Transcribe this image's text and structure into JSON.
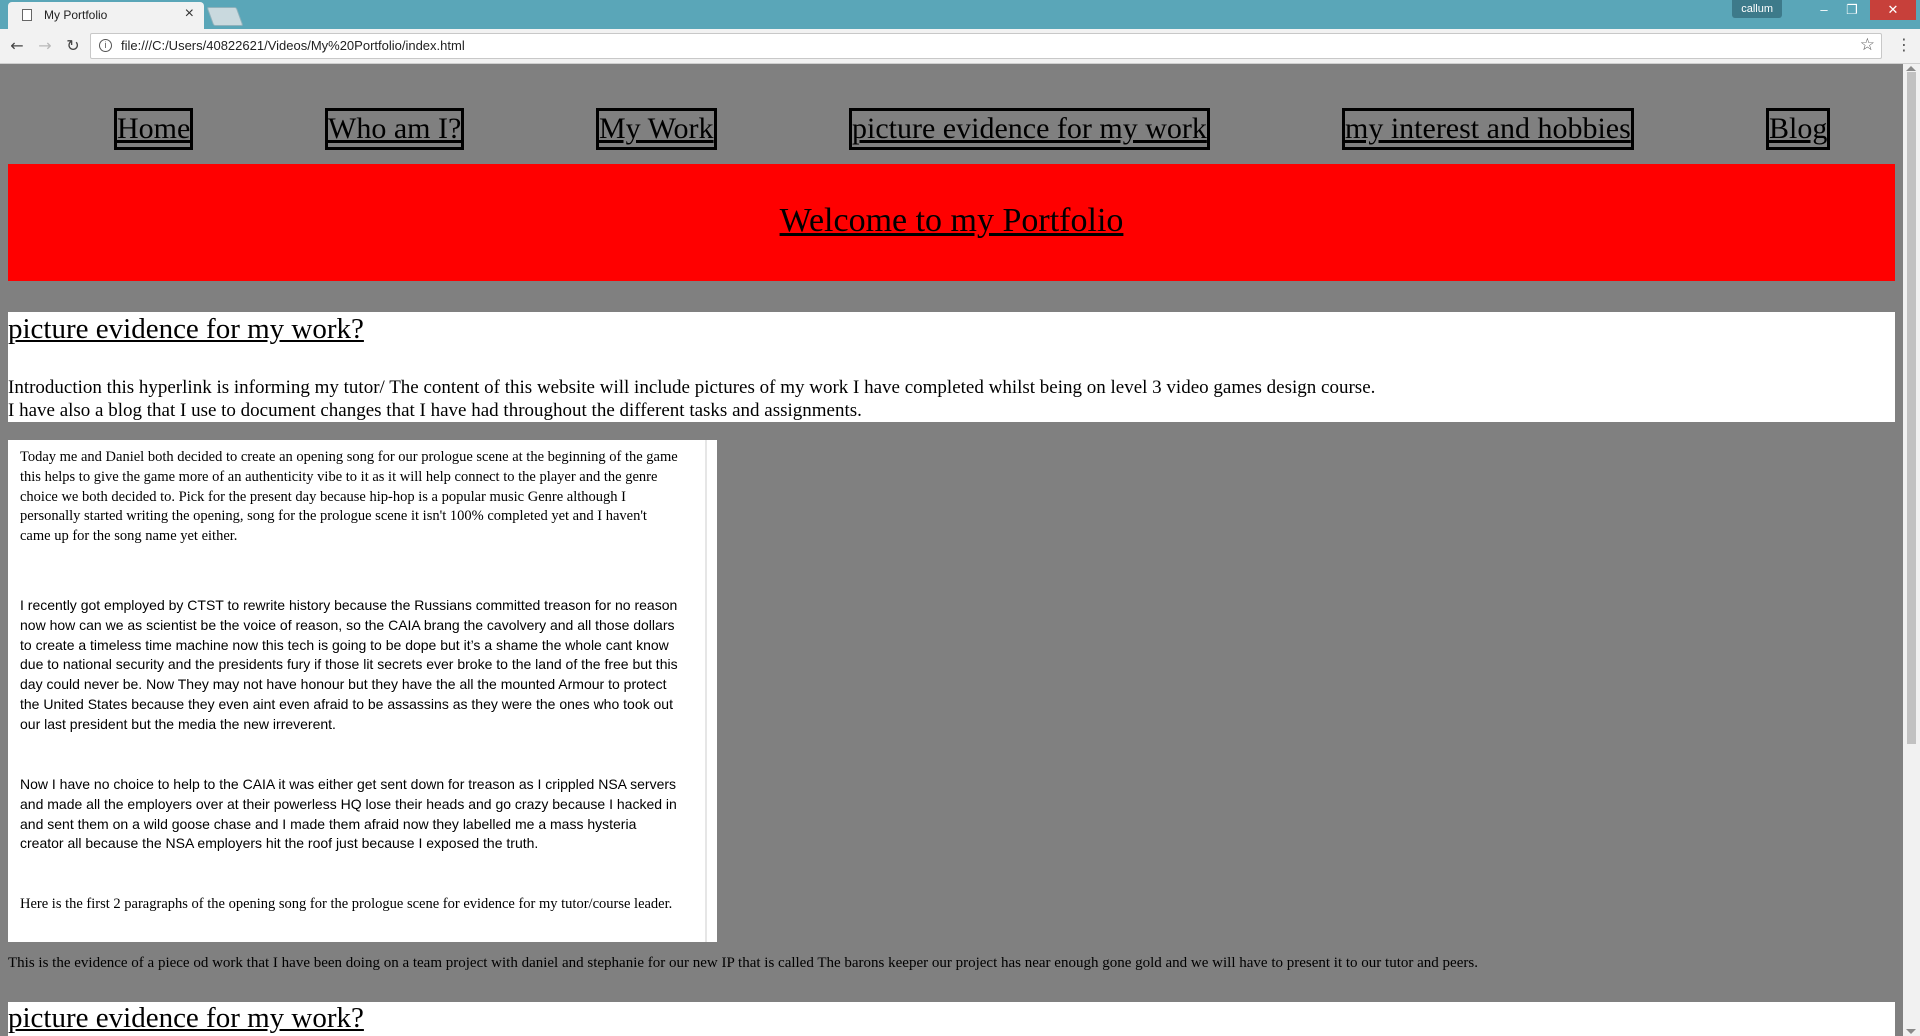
{
  "browser": {
    "tab_title": "My Portfolio",
    "tab_close": "×",
    "user_name": "callum",
    "window_min": "–",
    "window_max": "❐",
    "window_close": "✕",
    "url": "file:///C:/Users/40822621/Videos/My%20Portfolio/index.html",
    "back_icon": "←",
    "forward_icon": "→",
    "reload_icon": "↻",
    "star_icon": "☆",
    "menu_icon": "⋮",
    "info_icon": "i"
  },
  "nav": {
    "items": [
      {
        "label": "Home"
      },
      {
        "label": "Who am I?"
      },
      {
        "label": "My Work"
      },
      {
        "label": "picture evidence for my work"
      },
      {
        "label": "my interest and hobbies"
      },
      {
        "label": "Blog"
      }
    ]
  },
  "banner": {
    "title": "Welcome to my Portfolio",
    "color": "#ff0000"
  },
  "intro": {
    "heading": "picture evidence for my work?",
    "line1": "Introduction this hyperlink is informing my tutor/ The content of this website will include pictures of my work I have completed whilst being on level 3 video games design course.",
    "line2": "I have also a blog that I use to document changes that I have had throughout the different tasks and assignments."
  },
  "document": {
    "paragraph1": "Today me and Daniel both decided to create an opening song for our prologue scene at the beginning of the game this helps to give the game more of an authenticity vibe to it as it will help connect to the player and the genre choice we both decided to. Pick for the present day because hip-hop is a popular music Genre although I personally started writing the opening, song for the prologue scene it isn't 100% completed yet and I haven't came up for the song name yet either.",
    "paragraph2": "I recently got employed by CTST to rewrite history because the Russians committed treason for no reason now how can we as scientist be the voice of reason, so the CAIA brang the cavolvery and all those dollars to create a timeless time machine now this tech is going to be dope but it’s a shame the whole cant know due to national security and the presidents fury if those lit secrets ever broke to the land of the free but this day could never be. Now They may not have honour but they have the all the mounted Armour to protect the United States because they even aint even afraid to be assassins as they were the ones who took out our last president but the media the new irreverent.",
    "paragraph3": " Now I have no choice to help to the CAIA it was either get sent down for treason as I crippled NSA servers and made all the employers over at their powerless HQ lose their heads and go crazy because I hacked in and sent them on a wild goose chase and I made them afraid now they labelled me a mass hysteria creator all because the NSA employers hit the roof just because I exposed the truth.",
    "paragraph4": "Here is the first 2 paragraphs of the opening song for the prologue scene for evidence for my tutor/course leader."
  },
  "caption": "This is the evidence of a piece od work that I have been doing on a team project with daniel and stephanie for our new IP that is called The barons keeper our project has near enough gone gold and we will have to present it to our tutor and peers.",
  "section2": {
    "heading": "picture evidence for my work?"
  }
}
